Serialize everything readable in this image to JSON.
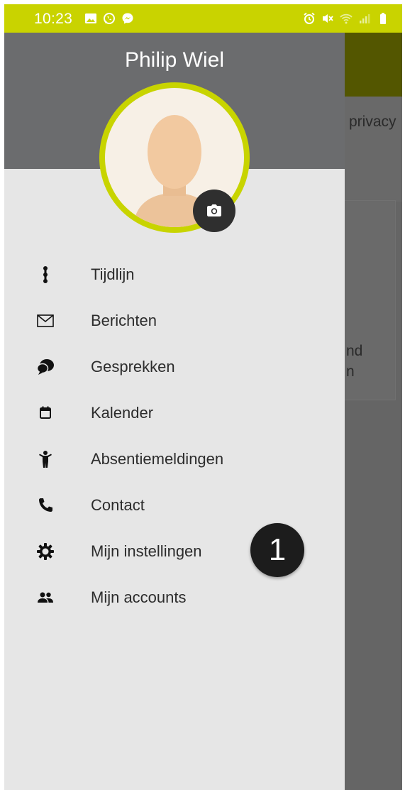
{
  "status_bar": {
    "time": "10:23",
    "background": "#c9d300",
    "left_icons": [
      "gallery-icon",
      "whatsapp-icon",
      "messenger-icon"
    ],
    "right_icons": [
      "alarm-icon",
      "mute-icon",
      "wifi-icon",
      "signal-icon",
      "battery-icon"
    ]
  },
  "background_app": {
    "text_privacy": "privacy",
    "text_fragment_1": "nd",
    "text_fragment_2": "n"
  },
  "drawer": {
    "profile_name": "Philip Wiel",
    "avatar_ring_color": "#c8d400",
    "camera_icon": "camera-icon",
    "menu": [
      {
        "label": "Tijdlijn",
        "icon": "timeline-icon"
      },
      {
        "label": "Berichten",
        "icon": "envelope-icon"
      },
      {
        "label": "Gesprekken",
        "icon": "chat-bubbles-icon"
      },
      {
        "label": "Kalender",
        "icon": "calendar-icon"
      },
      {
        "label": "Absentiemeldingen",
        "icon": "child-icon"
      },
      {
        "label": "Contact",
        "icon": "phone-icon"
      },
      {
        "label": "Mijn instellingen",
        "icon": "gear-icon"
      },
      {
        "label": "Mijn accounts",
        "icon": "people-icon"
      }
    ]
  },
  "annotation": {
    "badge_number": "1"
  }
}
